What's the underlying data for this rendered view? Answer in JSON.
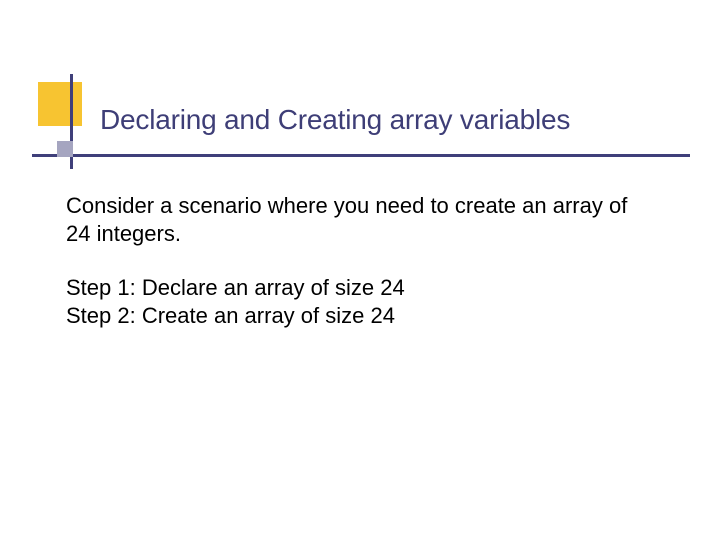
{
  "slide": {
    "title": "Declaring and Creating array variables",
    "intro": "Consider a scenario where you need to create an array of 24 integers.",
    "step1": "Step 1: Declare an array of size 24",
    "step2": "Step 2: Create an array of size 24"
  }
}
